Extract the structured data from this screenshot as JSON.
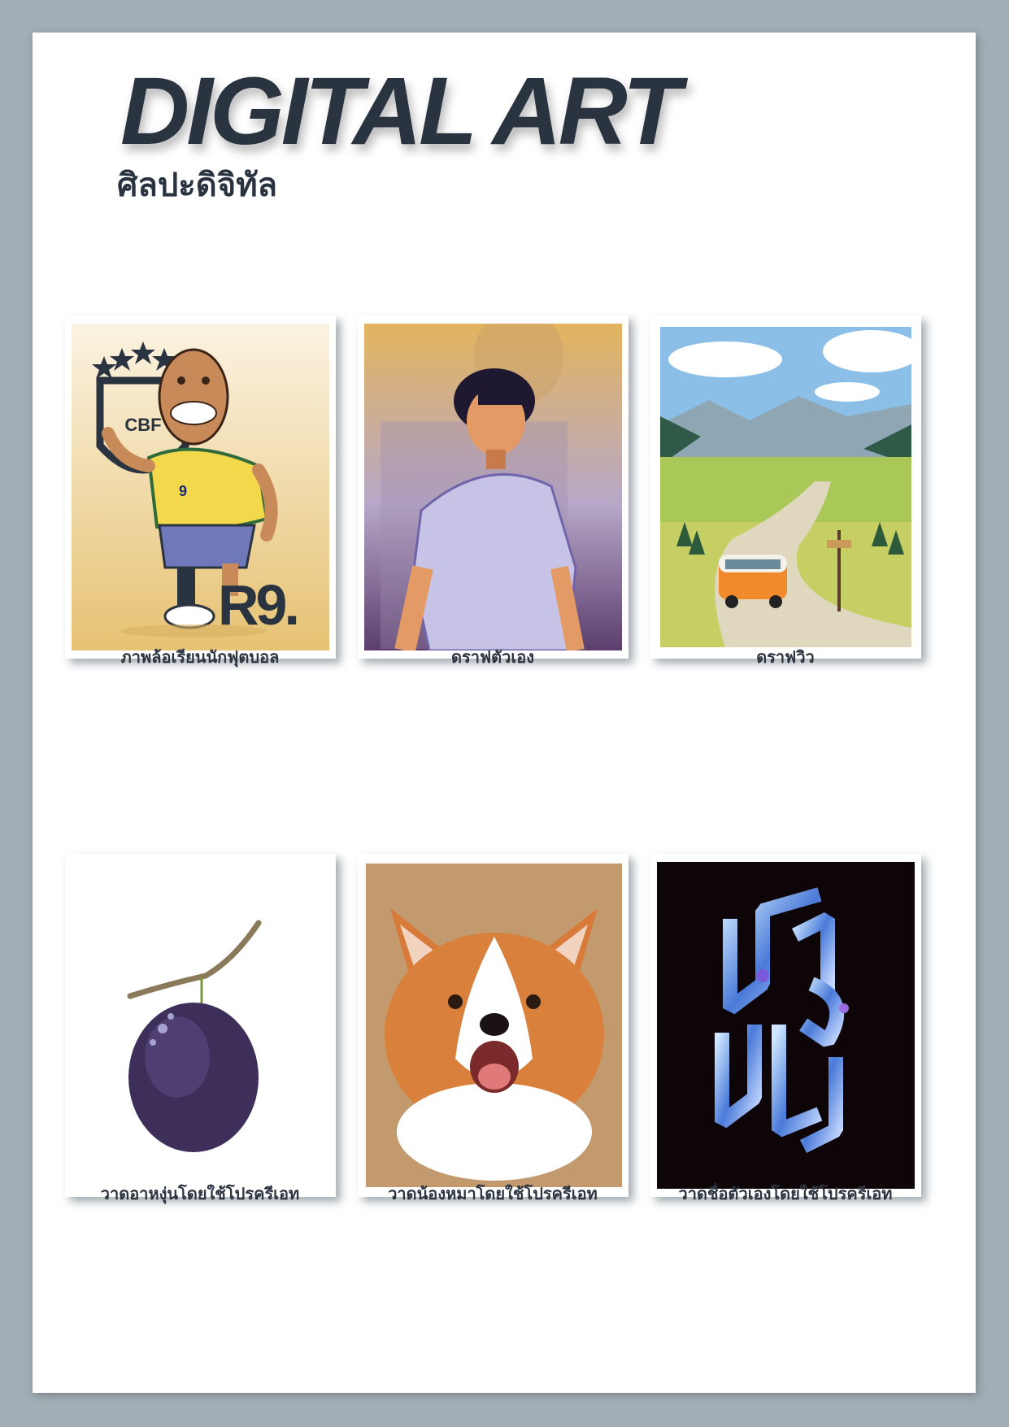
{
  "header": {
    "title": "DIGITAL ART",
    "subtitle": "ศิลปะดิจิทัล"
  },
  "gallery": {
    "items": [
      {
        "caption": "ภาพล้อเรียนนักฟุตบอล",
        "icon": "football-caricature-image",
        "accent": "#e8c77a",
        "badge_text": "R9.",
        "crest_text": "CBF",
        "jersey_number": "9"
      },
      {
        "caption": "ดราฟตัวเอง",
        "icon": "self-portrait-image",
        "accent": "#d7b26c"
      },
      {
        "caption": "ดราฟวิว",
        "icon": "landscape-van-image",
        "accent": "#8cbfe8"
      },
      {
        "caption": "วาดอาหงุ่นโดยใช้โปรครีเอท",
        "icon": "plum-fruit-image",
        "accent": "#3d2f5a"
      },
      {
        "caption": "วาดน้องหมาโดยใช้โปรครีเอท",
        "icon": "corgi-dog-image",
        "accent": "#c29a6d"
      },
      {
        "caption": "วาดชื่อตัวเองโดยใช้โปรครีเอท",
        "icon": "name-lettering-image",
        "accent": "#0d0507"
      }
    ]
  }
}
